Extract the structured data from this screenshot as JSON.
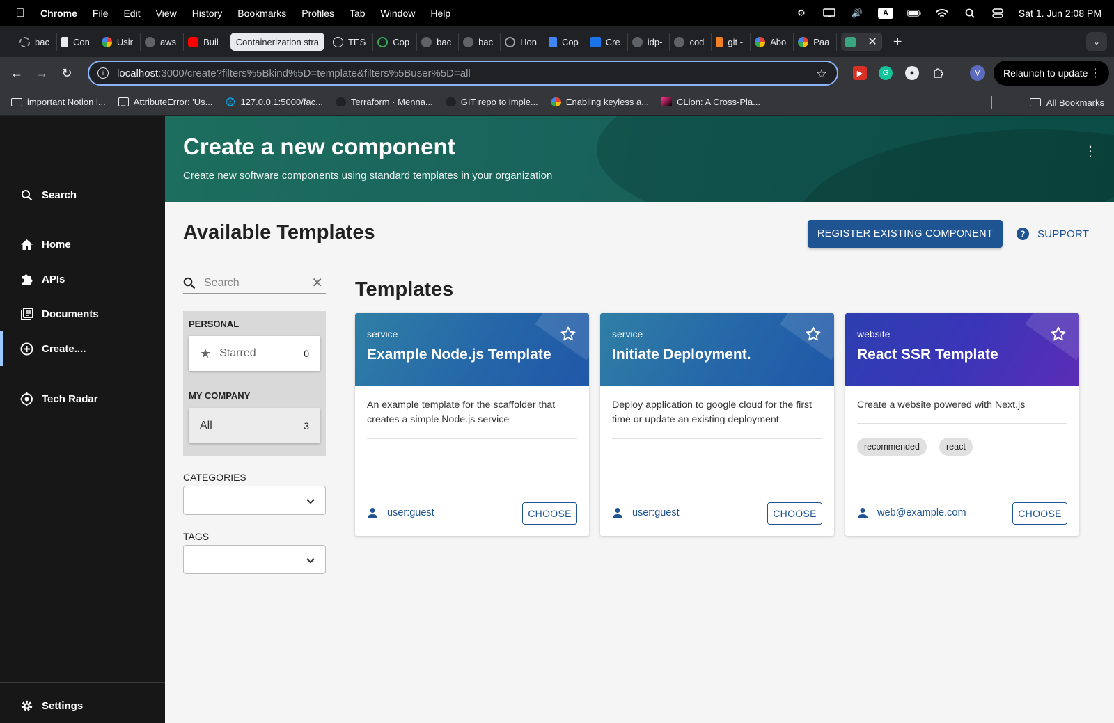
{
  "menubar": {
    "app": "Chrome",
    "items": [
      "File",
      "Edit",
      "View",
      "History",
      "Bookmarks",
      "Profiles",
      "Tab",
      "Window",
      "Help"
    ],
    "clock": "Sat 1. Jun  2:08 PM",
    "input_source": "A"
  },
  "tabs": {
    "items": [
      {
        "label": "bac",
        "color": "#9aa0a6"
      },
      {
        "label": "Con",
        "color": "#e8eaed"
      },
      {
        "label": "Usir",
        "color": "#4285f4"
      },
      {
        "label": "aws",
        "color": "#9aa0a6"
      },
      {
        "label": "Buil",
        "color": "#ff0000"
      },
      {
        "label": "TES",
        "color": "#9aa0a6"
      },
      {
        "label": "Cop",
        "color": "#34a853"
      },
      {
        "label": "bac",
        "color": "#5f6368"
      },
      {
        "label": "bac",
        "color": "#5f6368"
      },
      {
        "label": "Hon",
        "color": "#9aa0a6"
      },
      {
        "label": "Cop",
        "color": "#4285f4"
      },
      {
        "label": "Cre",
        "color": "#1a73e8"
      },
      {
        "label": "idp-",
        "color": "#5f6368"
      },
      {
        "label": "cod",
        "color": "#5f6368"
      },
      {
        "label": "git -",
        "color": "#f48024"
      },
      {
        "label": "Abo",
        "color": "#4285f4"
      },
      {
        "label": "Paa",
        "color": "#4285f4"
      }
    ],
    "active_label": "Containerization stra",
    "current_color": "#3aa67f"
  },
  "toolbar": {
    "url_host": "localhost",
    "url_path": ":3000/create?filters%5Bkind%5D=template&filters%5Buser%5D=all",
    "profile_initial": "M",
    "relaunch_label": "Relaunch to update"
  },
  "bookmarks": {
    "items": [
      "important Notion l...",
      "AttributeError: 'Us...",
      "127.0.0.1:5000/fac...",
      "Terraform · Menna...",
      "GIT repo to imple...",
      "Enabling keyless a...",
      "CLion: A Cross-Pla..."
    ],
    "all_label": "All Bookmarks"
  },
  "sidebar": {
    "search": "Search",
    "items": [
      "Home",
      "APIs",
      "Documents",
      "Create....",
      "Tech Radar"
    ],
    "settings": "Settings",
    "accent": "#9cc9ff"
  },
  "header": {
    "title": "Create a new component",
    "subtitle": "Create new software components using standard templates in your organization"
  },
  "main": {
    "title": "Available Templates",
    "register_label": "REGISTER EXISTING COMPONENT",
    "support_label": "SUPPORT",
    "accent": "#1f5493"
  },
  "filters": {
    "search_placeholder": "Search",
    "personal_label": "PERSONAL",
    "starred_label": "Starred",
    "starred_count": "0",
    "company_label": "MY COMPANY",
    "all_label": "All",
    "all_count": "3",
    "categories_label": "CATEGORIES",
    "tags_label": "TAGS"
  },
  "templates": {
    "title": "Templates",
    "choose_label": "CHOOSE",
    "cards": [
      {
        "kind": "service",
        "name": "Example Node.js Template",
        "description": "An example template for the scaffolder that creates a simple Node.js service",
        "owner": "user:guest",
        "tags": []
      },
      {
        "kind": "service",
        "name": "Initiate Deployment.",
        "description": "Deploy application to google cloud for the first time or update an existing deployment.",
        "owner": "user:guest",
        "tags": []
      },
      {
        "kind": "website",
        "name": "React SSR Template",
        "description": "Create a website powered with Next.js",
        "owner": "web@example.com",
        "tags": [
          "recommended",
          "react"
        ]
      }
    ]
  }
}
